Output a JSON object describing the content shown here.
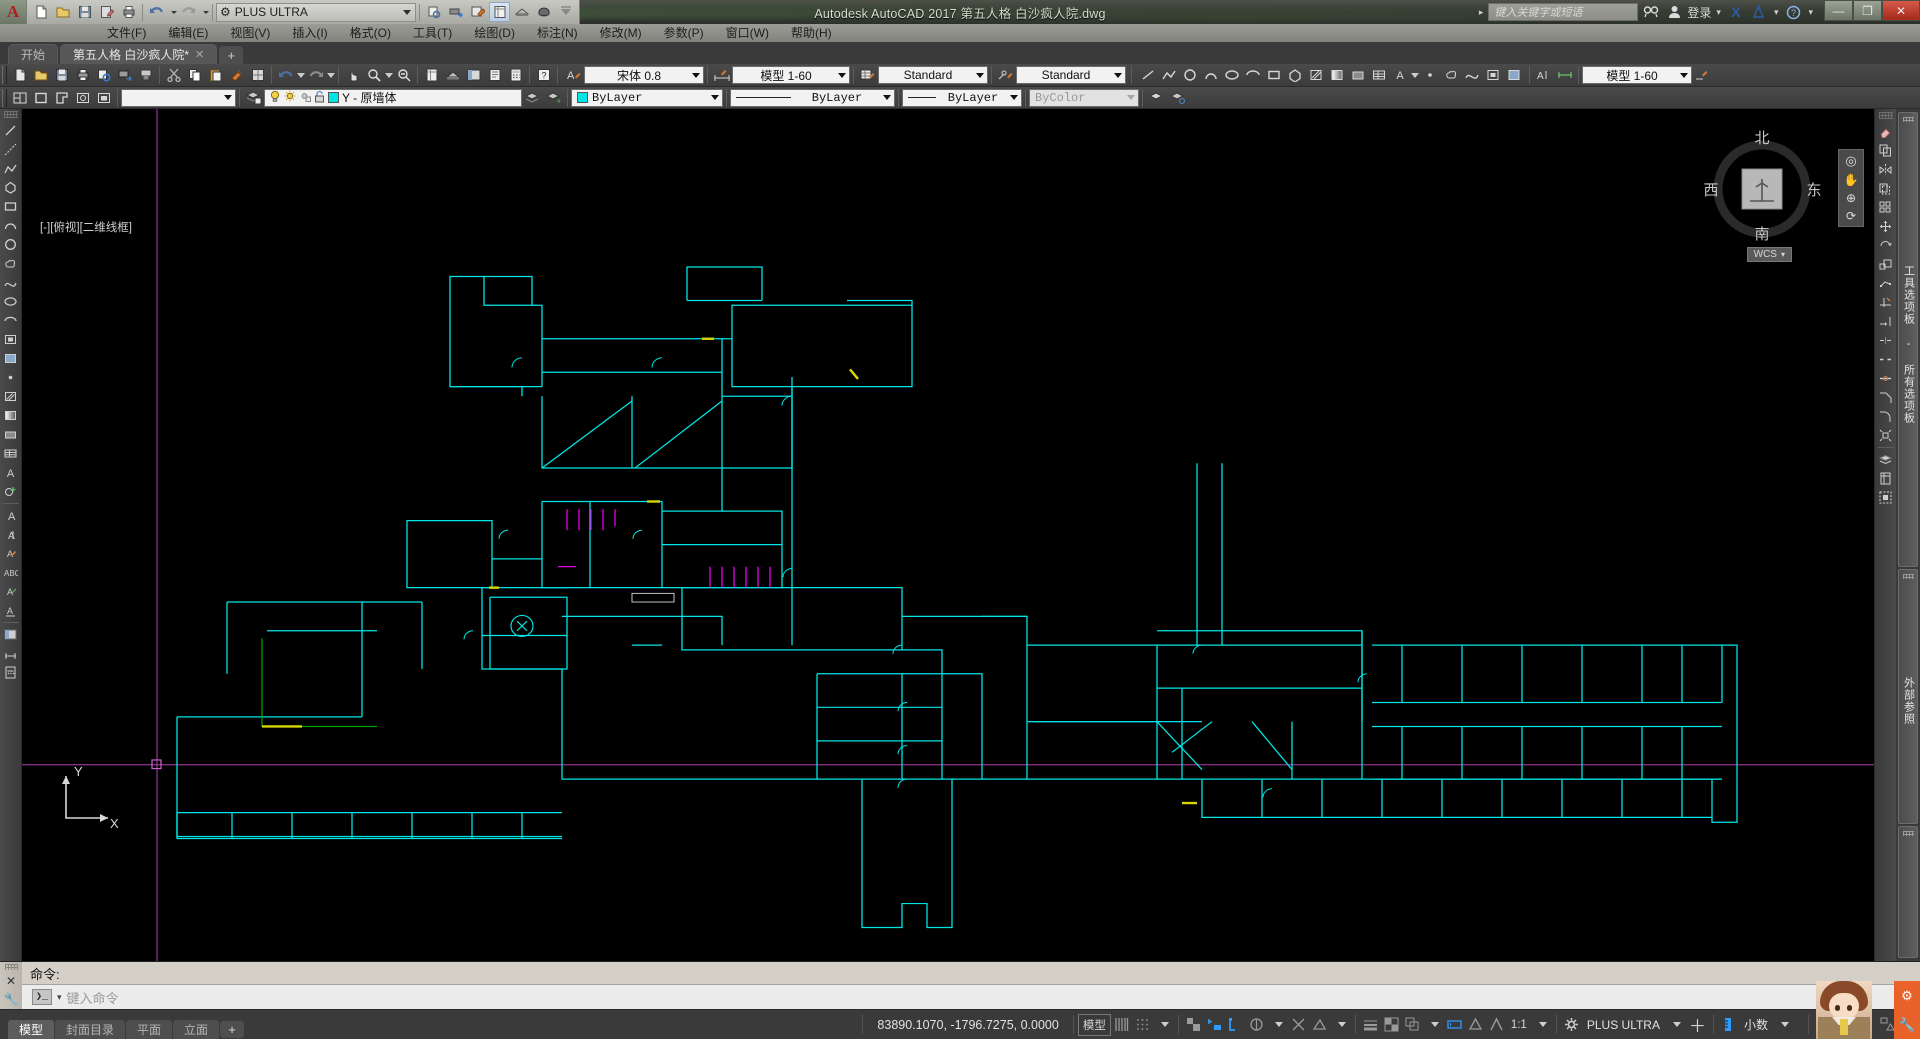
{
  "titlebar": {
    "app_title": "Autodesk AutoCAD 2017    第五人格 白沙疯人院.dwg",
    "workspace": "PLUS ULTRA",
    "search_placeholder": "键入关键字或短语",
    "signin_label": "登录",
    "minimize": "—",
    "maximize": "❐",
    "close": "✕",
    "icons": {
      "app_logo": "autocad-logo-icon",
      "new": "new-file-icon",
      "open": "open-folder-icon",
      "save": "save-icon",
      "saveas": "save-as-icon",
      "plot": "plot-icon",
      "undo": "undo-icon",
      "redo": "redo-icon",
      "workspace_gear": "gear-icon",
      "preview": "plot-preview-icon",
      "publish": "publish-icon",
      "batch": "batch-plot-icon",
      "properties": "properties-icon",
      "render": "render-icon",
      "sheet": "sheetset-icon",
      "more": "more-icon",
      "search": "search-icon",
      "user": "user-icon",
      "exchange": "autodesk-exchange-icon",
      "a360": "a360-icon",
      "help": "help-icon"
    }
  },
  "menubar": {
    "items": [
      {
        "label": "文件(F)"
      },
      {
        "label": "编辑(E)"
      },
      {
        "label": "视图(V)"
      },
      {
        "label": "插入(I)"
      },
      {
        "label": "格式(O)"
      },
      {
        "label": "工具(T)"
      },
      {
        "label": "绘图(D)"
      },
      {
        "label": "标注(N)"
      },
      {
        "label": "修改(M)"
      },
      {
        "label": "参数(P)"
      },
      {
        "label": "窗口(W)"
      },
      {
        "label": "帮助(H)"
      }
    ]
  },
  "doctabs": {
    "start": "开始",
    "drawing": "第五人格 白沙疯人院*",
    "close_glyph": "✕",
    "new_tab_glyph": "+"
  },
  "toolbar_row1": {
    "text_style": "宋体 0.8",
    "dim_style_left": "模型 1-60",
    "table_style": "Standard",
    "mleader_style": "Standard",
    "dim_style_right": "模型 1-60"
  },
  "toolbar_row2": {
    "block_combo_value": "",
    "layer": "Y - 原墙体",
    "color": "ByLayer",
    "linetype": "ByLayer",
    "lineweight": "ByLayer",
    "plotstyle": "ByColor"
  },
  "canvas": {
    "viewport_label": "[-][俯视][二维线框]",
    "ucs_x": "X",
    "ucs_y": "Y",
    "compass": {
      "north": "北",
      "south": "南",
      "east": "东",
      "west": "西",
      "top_face": "上",
      "wcs_label": "WCS"
    }
  },
  "palettes": {
    "items": [
      {
        "label": "工具选项板 - 所有选项板",
        "name": "tool-palettes"
      },
      {
        "label": "外部参照",
        "name": "xref-palette"
      },
      {
        "label": "",
        "name": "third-palette"
      }
    ]
  },
  "command_line": {
    "history": "命令:",
    "placeholder": "键入命令",
    "prompt_glyph": "❯_"
  },
  "statusbar": {
    "tabs": [
      {
        "label": "模型",
        "active": true
      },
      {
        "label": "封面目录",
        "active": false
      },
      {
        "label": "平面",
        "active": false
      },
      {
        "label": "立面",
        "active": false
      }
    ],
    "new_layout_glyph": "+",
    "coordinates": "83890.1070, -1796.7275, 0.0000",
    "space_mode": "模型",
    "scale": "1:1",
    "workspace": "PLUS ULTRA",
    "units": "小数",
    "icons": {
      "grid": "grid-icon",
      "snap": "snap-icon",
      "ortho": "ortho-icon",
      "polar": "polar-tracking-icon",
      "osnap": "object-snap-icon",
      "otrack": "object-snap-tracking-icon",
      "lineweight": "lineweight-icon",
      "transparency": "transparency-icon",
      "selection_cycling": "selection-cycling-icon",
      "annotation_visibility": "annotation-visibility-icon",
      "annotation_scale_auto": "annotation-autoscale-icon",
      "workspace_gear": "gear-icon",
      "customize": "customize-icon",
      "units_ruler": "units-icon",
      "quickprops": "quick-properties-icon",
      "lock_ui": "lock-ui-icon",
      "isolate": "isolate-objects-icon",
      "cleanscreen": "clean-screen-icon",
      "hardware_accel": "hardware-acceleration-icon"
    }
  },
  "colors": {
    "canvas_bg": "#000000",
    "drawing_cyan": "#00e5e5",
    "drawing_magenta": "#e600e6",
    "drawing_green": "#00a000",
    "drawing_yellow": "#d8d800",
    "ucs_axis": "#d8d8d8",
    "crosshair_magenta": "#c040c0",
    "ui_chrome": "#3a3a3a",
    "accent_blue": "#2e9bff",
    "titlebar_green": "#4d5148"
  }
}
